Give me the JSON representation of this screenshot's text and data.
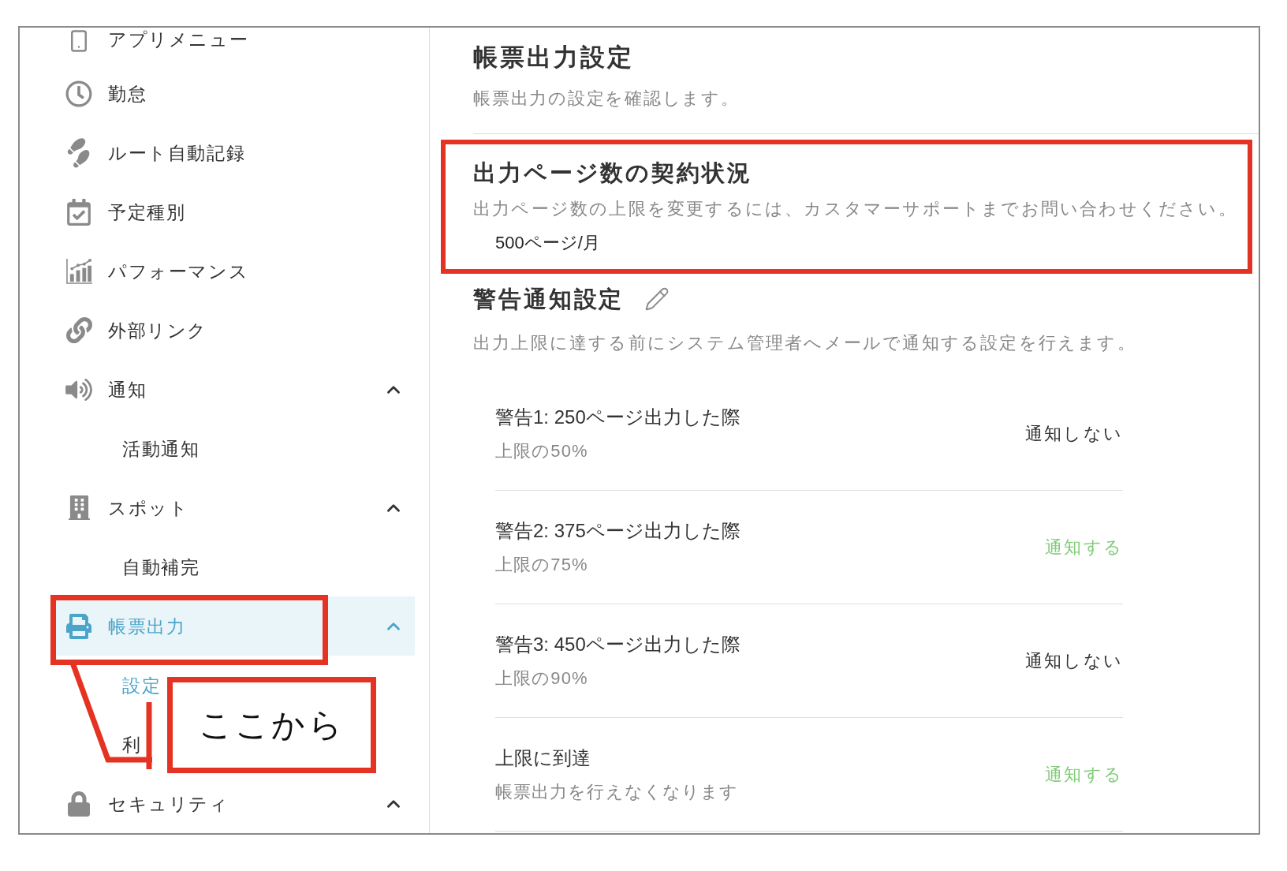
{
  "sidebar": {
    "items": [
      {
        "kind": "link",
        "label": "アプリメニュー",
        "selected": false,
        "annotated": false
      },
      {
        "kind": "link",
        "label": "勤怠",
        "selected": false,
        "annotated": false
      },
      {
        "kind": "link",
        "label": "ルート自動記録",
        "selected": false,
        "annotated": false
      },
      {
        "kind": "link",
        "label": "予定種別",
        "selected": false,
        "annotated": false
      },
      {
        "kind": "link",
        "label": "パフォーマンス",
        "selected": false,
        "annotated": false
      },
      {
        "kind": "link",
        "label": "外部リンク",
        "selected": false,
        "annotated": false
      },
      {
        "kind": "group",
        "label": "通知",
        "selected": false,
        "annotated": false,
        "expanded": true,
        "children": [
          {
            "label": "活動通知",
            "selected": false
          }
        ]
      },
      {
        "kind": "group",
        "label": "スポット",
        "selected": false,
        "annotated": false,
        "expanded": true,
        "children": [
          {
            "label": "自動補完",
            "selected": false
          }
        ]
      },
      {
        "kind": "group",
        "label": "帳票出力",
        "selected": true,
        "annotated": true,
        "expanded": true,
        "children": [
          {
            "label": "設定",
            "selected": true
          },
          {
            "label": "利",
            "selected": false
          }
        ]
      },
      {
        "kind": "group",
        "label": "セキュリティ",
        "selected": false,
        "annotated": false,
        "expanded": true
      }
    ]
  },
  "page": {
    "title": "帳票出力設定",
    "description": "帳票出力の設定を確認します。"
  },
  "contract": {
    "annotated": true,
    "heading": "出力ページ数の契約状況",
    "note": "出力ページ数の上限を変更するには、カスタマーサポートまでお問い合わせください。",
    "value": "500ページ/月"
  },
  "warning": {
    "heading": "警告通知設定",
    "description": "出力上限に達する前にシステム管理者へメールで通知する設定を行えます。",
    "rows": [
      {
        "title": "警告1: 250ページ出力した際",
        "sub": "上限の50%",
        "status": "通知しない",
        "on": false
      },
      {
        "title": "警告2: 375ページ出力した際",
        "sub": "上限の75%",
        "status": "通知する",
        "on": true
      },
      {
        "title": "警告3: 450ページ出力した際",
        "sub": "上限の90%",
        "status": "通知しない",
        "on": false
      },
      {
        "title": "上限に到達",
        "sub": "帳票出力を行えなくなります",
        "status": "通知する",
        "on": true
      }
    ]
  },
  "callout": {
    "text": "ここから"
  }
}
